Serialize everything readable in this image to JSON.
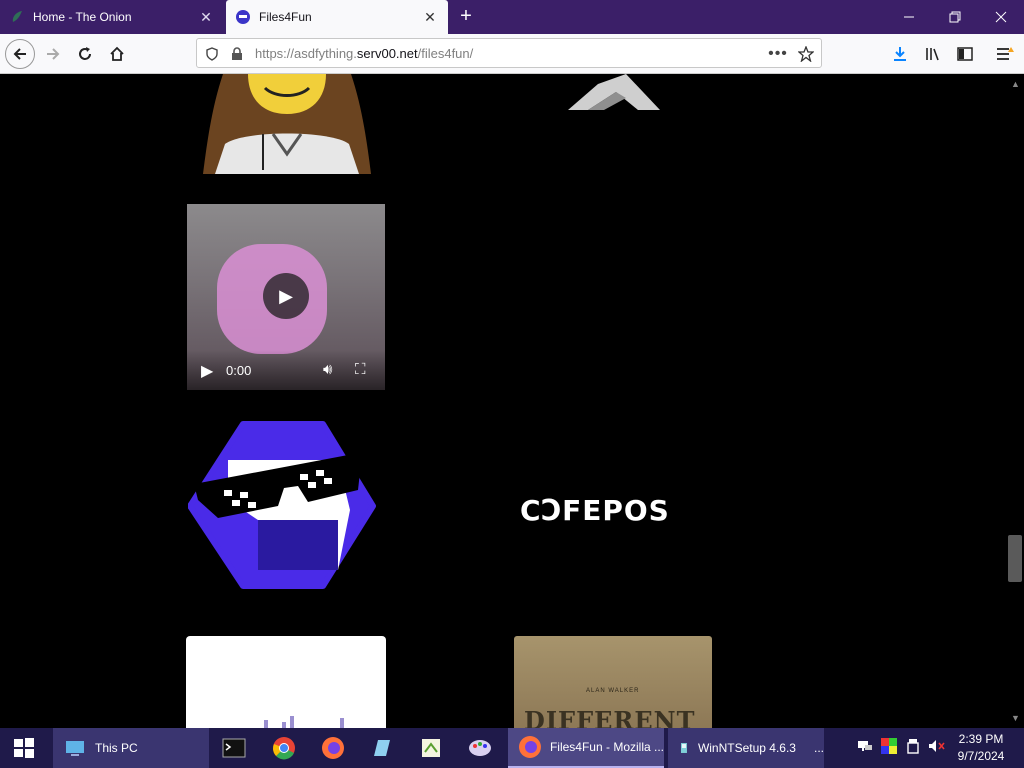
{
  "browser": {
    "tabs": [
      {
        "title": "Home - The Onion",
        "active": false
      },
      {
        "title": "Files4Fun",
        "active": true
      }
    ],
    "new_tab_label": "+",
    "url": {
      "scheme_prefix": "https://asdfything.",
      "host": "serv00.net",
      "path": "/files4fun/"
    }
  },
  "page": {
    "video": {
      "time": "0:00"
    },
    "cofepos_text": "CϽFEPOS",
    "album": {
      "artist": "ALAN WALKER",
      "title_partial": "DIFFERENT"
    }
  },
  "taskbar": {
    "items": [
      {
        "label": "This PC"
      },
      {
        "label": "Files4Fun - Mozilla ..."
      },
      {
        "label": "WinNTSetup 4.6.3"
      }
    ],
    "winnt_more": "...",
    "clock": {
      "time": "2:39 PM",
      "date": "9/7/2024"
    }
  },
  "colors": {
    "tab_strip": "#3b1f68",
    "taskbar": "#1f1a4a",
    "page_bg": "#000000"
  }
}
